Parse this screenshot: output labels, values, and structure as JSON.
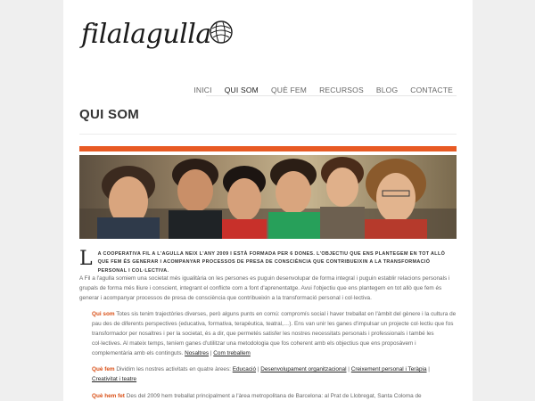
{
  "site": {
    "logo_text": "filalagulla"
  },
  "nav": [
    {
      "label": "INICI"
    },
    {
      "label": "QUI SOM"
    },
    {
      "label": "QUÈ FEM"
    },
    {
      "label": "RECURSOS"
    },
    {
      "label": "BLOG"
    },
    {
      "label": "CONTACTE"
    }
  ],
  "page": {
    "title": "QUI SOM"
  },
  "colors": {
    "accent": "#e85a24",
    "lead": "#d94f16"
  },
  "intro": {
    "dropcap": "L",
    "text": "A COOPERATIVA FIL A L'AGULLA NEIX L'ANY 2009 I ESTÀ FORMADA PER 6 DONES. L'OBJECTIU QUE ENS PLANTEGEM EN TOT ALLÒ QUE FEM ÉS GENERAR I ACOMPANYAR PROCESSOS DE PRESA DE CONSCIÈNCIA QUE CONTRIBUEIXIN A LA TRANSFORMACIÓ PERSONAL I COL·LECTIVA."
  },
  "p1": "A Fil a l'agulla somiem una societat més igualitària on les persones es puguin desenvolupar de forma integral i puguin establir relacions personals i grupals de forma més lliure i conscient, integrant el conflicte com a font d'aprenentatge. Avui l'objectiu que ens plantegem en tot allò que fem és generar i acompanyar processos de presa de consciència que contribueixin a la transformació personal i col·lectiva.",
  "p2": {
    "lead": "Qui som",
    "text": " Totes sis tenim trajectòries diverses, però alguns punts en comú: compromís social i haver treballat en l'àmbit del gènere i la cultura de pau des de diferents perspectives (educativa, formativa, terapèutica, teatral,…). Ens van unir les ganes d'impulsar un projecte col·lectiu que fos transformador per nosaltres i per la societat, és a dir, que permetés satisfer les nostres necessitats personals i professionals i també les col·lectives.  Al mateix temps, teníem ganes d'utilitzar una metodologia que fos coherent amb els objectius que ens proposàvem i complementària amb els continguts. ",
    "link1": "Nosaltres",
    "sep": " | ",
    "link2": "Com treballem"
  },
  "p3": {
    "lead": "Què fem",
    "text": "  Dividim les nostres activitats en quatre àrees: ",
    "links": [
      "Educació",
      "Desenvolupament organitzacional",
      "Creixement personal i Teràpia",
      "Creativitat i teatre"
    ],
    "sep": " | "
  },
  "p4": {
    "lead": "Què hem fet",
    "text": "  Des del 2009 hem treballat principalment a l'àrea metropolitana de Barcelona: al Prat de Llobregat, Santa Coloma de"
  }
}
